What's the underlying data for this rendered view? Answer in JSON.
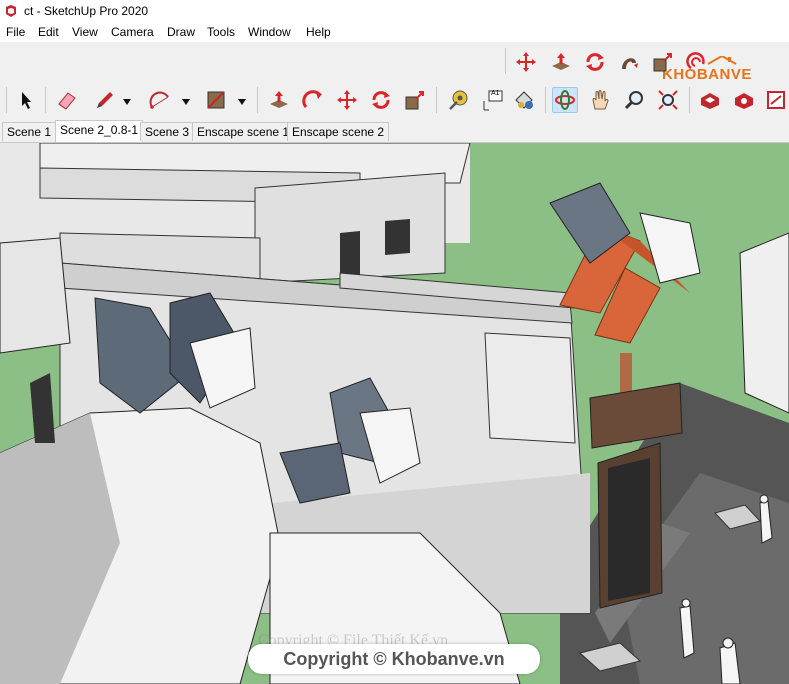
{
  "window": {
    "title": "ct - SketchUp Pro 2020"
  },
  "menu": [
    {
      "label": "File"
    },
    {
      "label": "Edit"
    },
    {
      "label": "View"
    },
    {
      "label": "Camera"
    },
    {
      "label": "Draw"
    },
    {
      "label": "Tools"
    },
    {
      "label": "Window"
    },
    {
      "label": "Help"
    }
  ],
  "logo": {
    "text": "KHOBANVE",
    "color": "#e8731c"
  },
  "toolbar": {
    "row1": [
      "move-icon",
      "push-pull-icon",
      "rotate-icon",
      "follow-me-icon",
      "scale-icon",
      "offset-icon"
    ],
    "row2": [
      "select-icon",
      "eraser-icon",
      "pencil-icon",
      "arc-icon",
      "rectangle-icon",
      "push-pull-icon",
      "follow-me-icon",
      "move-icon",
      "rotate-icon",
      "scale-icon",
      "tape-measure-icon",
      "text-icon",
      "paint-bucket-icon",
      "orbit-icon",
      "pan-icon",
      "zoom-icon",
      "zoom-extents-icon",
      "warehouse-icon",
      "extension-icon",
      "layout-icon"
    ],
    "text_tool_label": "A1"
  },
  "scenes": [
    {
      "label": "Scene 1",
      "active": false
    },
    {
      "label": "Scene 2_0.8-1",
      "active": true
    },
    {
      "label": "Scene 3",
      "active": false
    },
    {
      "label": "Enscape scene 1",
      "active": false
    },
    {
      "label": "Enscape scene 2",
      "active": false
    }
  ],
  "viewport": {
    "background": "#8cbf85"
  },
  "watermark": {
    "text": "Copyright © Khobanve.vn",
    "faint": "Copyright © File Thiết Kế.vn"
  }
}
